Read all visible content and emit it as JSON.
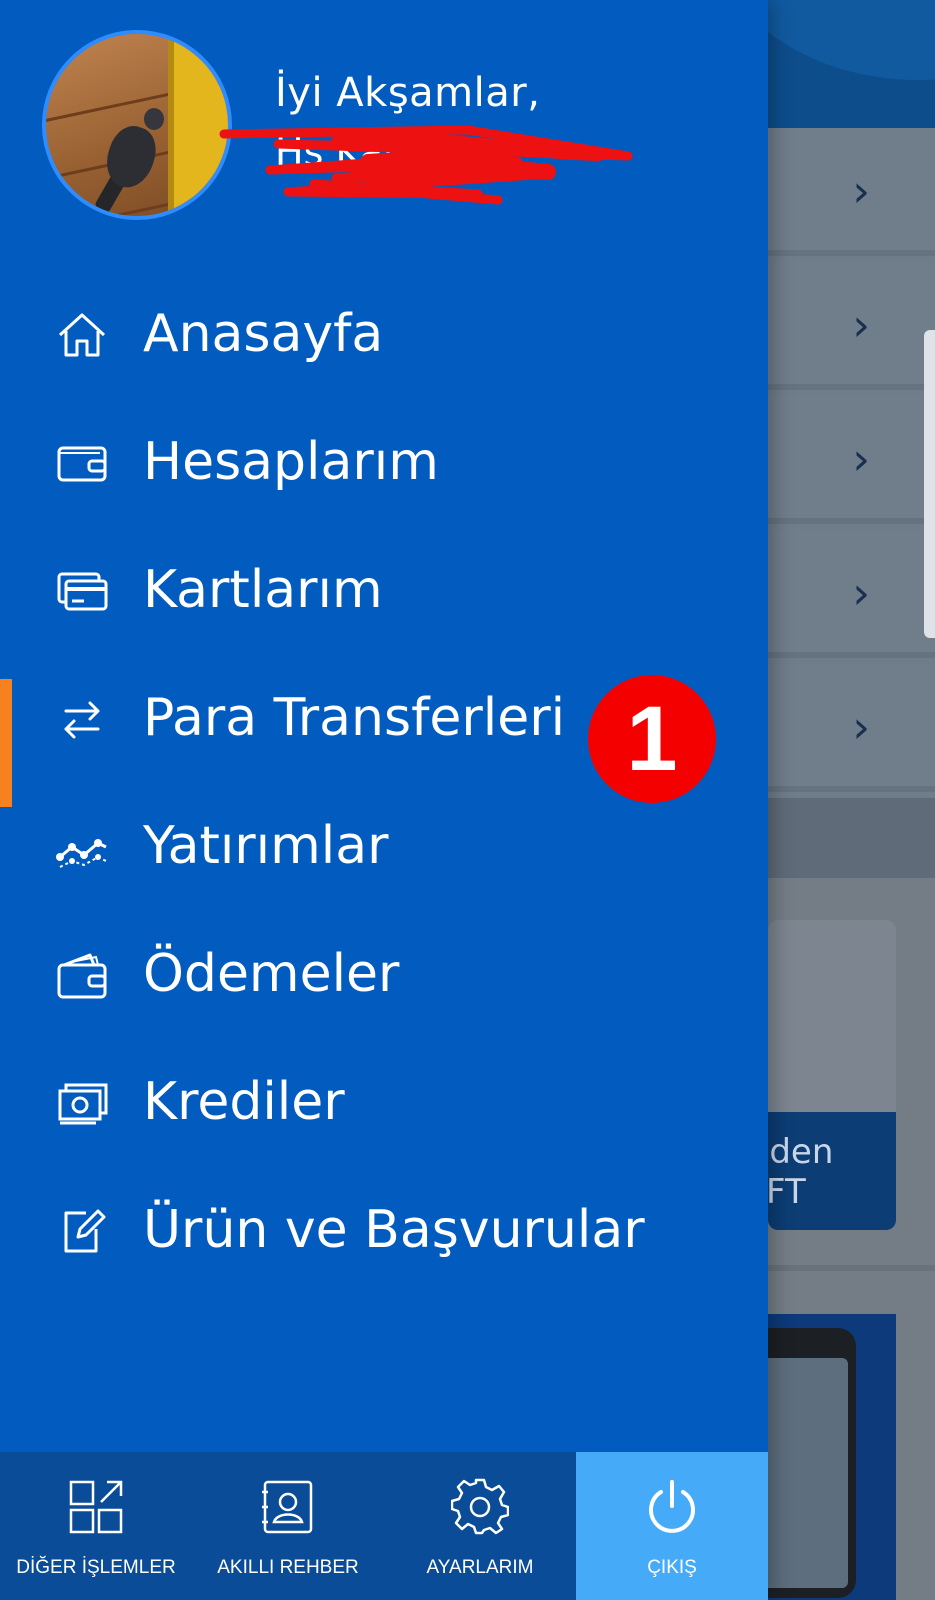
{
  "greeting": "İyi Akşamlar,",
  "user_name_redacted": "Hş    Kar",
  "menu": {
    "items": [
      {
        "label": "Anasayfa",
        "icon": "home-icon"
      },
      {
        "label": "Hesaplarım",
        "icon": "wallet-icon"
      },
      {
        "label": "Kartlarım",
        "icon": "cards-icon"
      },
      {
        "label": "Para Transferleri",
        "icon": "transfer-arrows-icon",
        "active": true
      },
      {
        "label": "Yatırımlar",
        "icon": "investment-graph-icon"
      },
      {
        "label": "Ödemeler",
        "icon": "payment-wallet-icon"
      },
      {
        "label": "Krediler",
        "icon": "credit-cash-icon"
      },
      {
        "label": "Ürün ve Başvurular",
        "icon": "edit-document-icon"
      }
    ]
  },
  "annotation": {
    "badge_number": "1"
  },
  "bottom_bar": {
    "items": [
      {
        "label": "DİĞER İŞLEMLER",
        "icon": "grid-arrow-icon"
      },
      {
        "label": "AKILLI REHBER",
        "icon": "contact-book-icon"
      },
      {
        "label": "AYARLARIM",
        "icon": "gear-icon"
      },
      {
        "label": "ÇIKIŞ",
        "icon": "power-icon"
      }
    ]
  },
  "background": {
    "card_text_line1": "'den",
    "card_text_line2": "FT"
  },
  "colors": {
    "drawer_bg": "#025cbf",
    "active_indicator": "#f5821f",
    "badge_red": "#f50000",
    "bottom_bar": "#0a4c97",
    "exit_button": "#45abf8"
  }
}
